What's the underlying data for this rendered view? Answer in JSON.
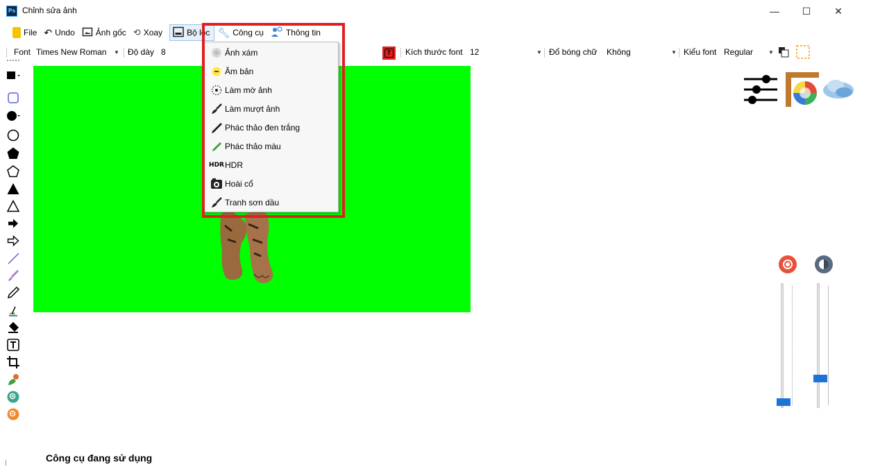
{
  "window": {
    "title": "Chỉnh sửa ảnh",
    "app_icon_text": "Ps",
    "minimize_glyph": "—",
    "maximize_glyph": "☐",
    "close_glyph": "✕"
  },
  "menubar": {
    "items": [
      {
        "label": "File",
        "icon": "file-icon"
      },
      {
        "label": "Undo",
        "icon": "undo-icon"
      },
      {
        "label": "Ảnh gốc",
        "icon": "original-image-icon"
      },
      {
        "label": "Xoay",
        "icon": "rotate-icon"
      },
      {
        "label": "Bộ lọc",
        "icon": "filter-icon",
        "active": true
      },
      {
        "label": "Công cụ",
        "icon": "tools-icon"
      },
      {
        "label": "Thông tin",
        "icon": "info-icon"
      }
    ]
  },
  "format_toolbar": {
    "font_label": "Font",
    "font_value": "Times New Roman",
    "thickness_label": "Độ dày",
    "thickness_value": "8",
    "font_size_label": "Kích thước font",
    "font_size_value": "12",
    "shadow_label": "Đổ bóng chữ",
    "shadow_value": "Không",
    "font_style_label": "Kiểu font",
    "font_style_value": "Regular",
    "text_color": "#e02020"
  },
  "filter_menu": {
    "items": [
      {
        "label": "Ảnh xám",
        "icon": "grayscale-icon"
      },
      {
        "label": "Âm bản",
        "icon": "negative-icon"
      },
      {
        "label": "Làm mờ ảnh",
        "icon": "blur-icon"
      },
      {
        "label": "Làm mượt ảnh",
        "icon": "smooth-icon"
      },
      {
        "label": "Phác thảo đen trắng",
        "icon": "bw-sketch-icon"
      },
      {
        "label": "Phác thảo màu",
        "icon": "color-sketch-icon"
      },
      {
        "label": "HDR",
        "icon": "hdr-icon",
        "icon_text": "HDR"
      },
      {
        "label": "Hoài cổ",
        "icon": "vintage-icon"
      },
      {
        "label": "Tranh sơn dầu",
        "icon": "oil-paint-icon"
      }
    ]
  },
  "canvas": {
    "background": "#00ff00"
  },
  "sliders": {
    "brightness": 0.02,
    "contrast": 0.22
  },
  "status": {
    "label": "Công cụ đang sử dụng"
  },
  "colors": {
    "accent": "#1b74d6",
    "highlight": "#e02020",
    "canvas": "#00ff00"
  }
}
